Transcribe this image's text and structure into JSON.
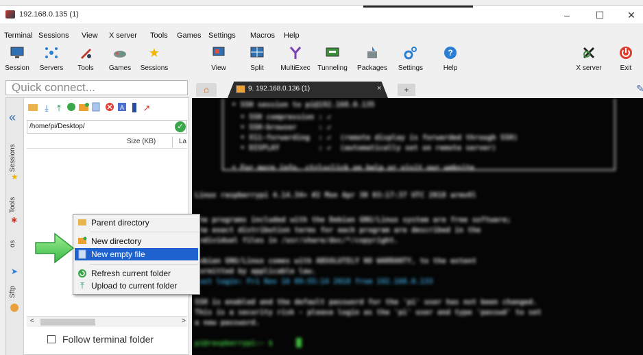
{
  "window": {
    "title": "192.168.0.135 (1)"
  },
  "window_controls": {
    "minimize": "–",
    "maximize": "☐",
    "close": "✕"
  },
  "menu": [
    "Terminal",
    "Sessions",
    "View",
    "X server",
    "Tools",
    "Games",
    "Settings",
    "Macros",
    "Help"
  ],
  "toolbar": {
    "session": "Session",
    "servers": "Servers",
    "tools": "Tools",
    "games": "Games",
    "sessions": "Sessions",
    "view": "View",
    "split": "Split",
    "multiexec": "MultiExec",
    "tunneling": "Tunneling",
    "packages": "Packages",
    "settings": "Settings",
    "help": "Help",
    "xserver": "X server",
    "exit": "Exit"
  },
  "quick_connect": {
    "placeholder": "Quick connect..."
  },
  "side_tabs": {
    "sessions": "Sessions",
    "tools": "Tools",
    "macros": "os",
    "sftp": "Sftp"
  },
  "sftp": {
    "path": "/home/pi/Desktop/",
    "columns": {
      "size": "Size (KB)",
      "last": "La"
    },
    "follow_terminal": "Follow terminal folder"
  },
  "tabs": {
    "home_icon": "home-icon",
    "terminal_tab": "9. 192.168.0.136 (1)",
    "close": "×",
    "add": "+"
  },
  "context_menu": {
    "parent_directory": "Parent directory",
    "new_directory": "New directory",
    "new_empty_file": "New empty file",
    "refresh": "Refresh current folder",
    "upload": "Upload to current folder"
  },
  "terminal_lines": {
    "l1": "• SSH session to pi@192.168.0.135",
    "l2": "  • SSH compression : ✔",
    "l3": "  • SSH-browser     : ✔",
    "l4": "  • X11-forwarding  : ✔  (remote display is forwarded through SSH)",
    "l5": "  • DISPLAY         : ✔  (automatically set on remote server)",
    "l6": "• For more info, ctrl+click on help or visit our website",
    "l7": "Linux raspberrypi 4.14.34+ #2 Mon Apr 30 03:17:37 UTC 2018 armv6l",
    "l8": "The programs included with the Debian GNU/Linux system are free software;",
    "l9": "the exact distribution terms for each program are described in the",
    "l10": "individual files in /usr/share/doc/*/copyright.",
    "l11": "Debian GNU/Linux comes with ABSOLUTELY NO WARRANTY, to the extent",
    "l12": "permitted by applicable law.",
    "l13": "Last login: Fri Nov 16 09:55:14 2018 from 192.168.0.133",
    "l14": "SSH is enabled and the default password for the 'pi' user has not been changed.",
    "l15": "This is a security risk - please login as the 'pi' user and type 'passwd' to set",
    "l16": "a new password.",
    "l17": "pi@raspberrypi:~ $ "
  },
  "colors": {
    "selection": "#1e62d0",
    "terminal_bg": "#050505",
    "accent_green": "#3fbf3f",
    "accent_magenta": "#c030c0"
  }
}
